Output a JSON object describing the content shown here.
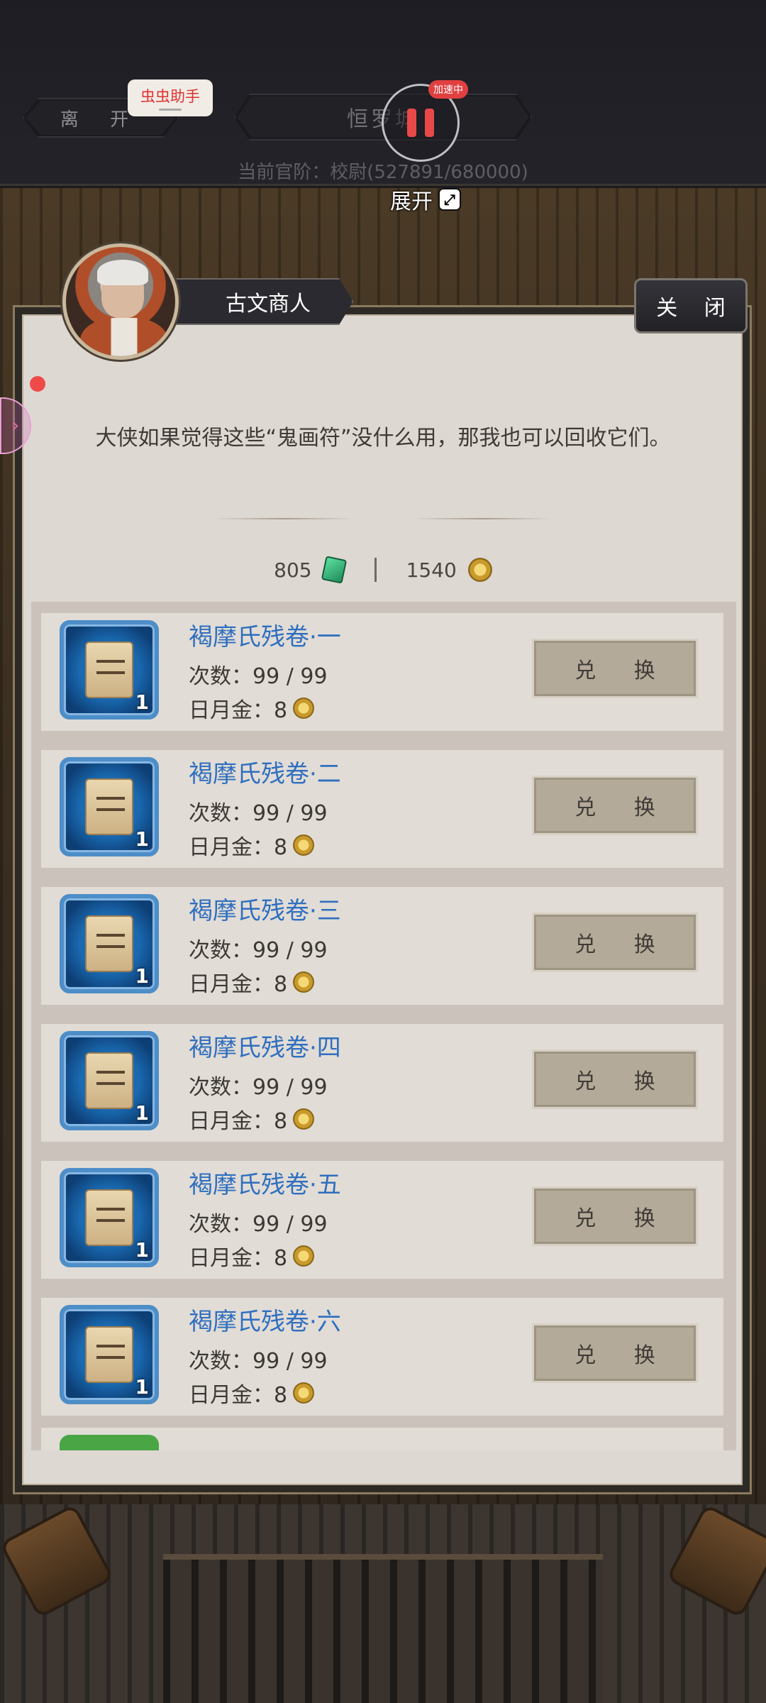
{
  "topbar": {
    "leave_label": "离 开",
    "city_label": "恒罗城",
    "rank_text": "当前官阶：校尉(527891/680000)",
    "helper_label": "虫虫助手",
    "speed_badge": "加速中",
    "expand_label": "展开"
  },
  "dialog": {
    "npc_name": "古文商人",
    "close_label": "关 闭",
    "message": "大侠如果觉得这些“鬼画符”没什么用，那我也可以回收它们。",
    "jade_amount": "805",
    "gold_amount": "1540"
  },
  "items": [
    {
      "name": "褐摩氏残卷·一",
      "times": "次数：99 / 99",
      "cost": "日月金：8",
      "count": "1",
      "button": "兑 换"
    },
    {
      "name": "褐摩氏残卷·二",
      "times": "次数：99 / 99",
      "cost": "日月金：8",
      "count": "1",
      "button": "兑 换"
    },
    {
      "name": "褐摩氏残卷·三",
      "times": "次数：99 / 99",
      "cost": "日月金：8",
      "count": "1",
      "button": "兑 换"
    },
    {
      "name": "褐摩氏残卷·四",
      "times": "次数：99 / 99",
      "cost": "日月金：8",
      "count": "1",
      "button": "兑 换"
    },
    {
      "name": "褐摩氏残卷·五",
      "times": "次数：99 / 99",
      "cost": "日月金：8",
      "count": "1",
      "button": "兑 换"
    },
    {
      "name": "褐摩氏残卷·六",
      "times": "次数：99 / 99",
      "cost": "日月金：8",
      "count": "1",
      "button": "兑 换"
    }
  ],
  "icons": {
    "jade": "jade-currency-icon",
    "gold": "gold-coin-icon",
    "pause": "pause-icon",
    "expand": "expand-icon"
  },
  "colors": {
    "item_name": "#2f6fbf",
    "speed_badge": "#e04040",
    "pause": "#e94848"
  }
}
